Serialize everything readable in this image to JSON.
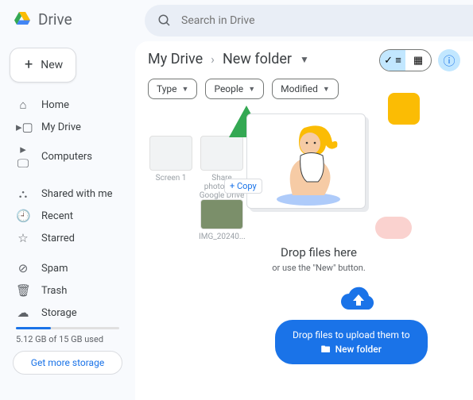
{
  "app": {
    "name": "Drive"
  },
  "search": {
    "placeholder": "Search in Drive"
  },
  "newButton": {
    "label": "New"
  },
  "sidebar": {
    "items": [
      {
        "label": "Home",
        "icon": "⌂"
      },
      {
        "label": "My Drive",
        "icon": "▸▢"
      },
      {
        "label": "Computers",
        "icon": "▸🖵"
      },
      {
        "label": "Shared with me",
        "icon": "⛬"
      },
      {
        "label": "Recent",
        "icon": "🕘"
      },
      {
        "label": "Starred",
        "icon": "☆"
      },
      {
        "label": "Spam",
        "icon": "⊘"
      },
      {
        "label": "Trash",
        "icon": "🗑"
      },
      {
        "label": "Storage",
        "icon": "☁"
      }
    ],
    "storage": {
      "text": "5.12 GB of 15 GB used",
      "cta": "Get more storage"
    }
  },
  "breadcrumb": {
    "root": "My Drive",
    "current": "New folder"
  },
  "filters": {
    "type": "Type",
    "people": "People",
    "modified": "Modified"
  },
  "dragGhosts": {
    "g1": "Screen 1",
    "g2": "Share photos on Google Drive 1",
    "g3": "IMG_20240..."
  },
  "copyBadge": "+ Copy",
  "dropzone": {
    "title": "Drop files here",
    "sub": "or use the \"New\" button."
  },
  "uploadPill": {
    "line1": "Drop files to upload them to",
    "folder": "New folder"
  }
}
